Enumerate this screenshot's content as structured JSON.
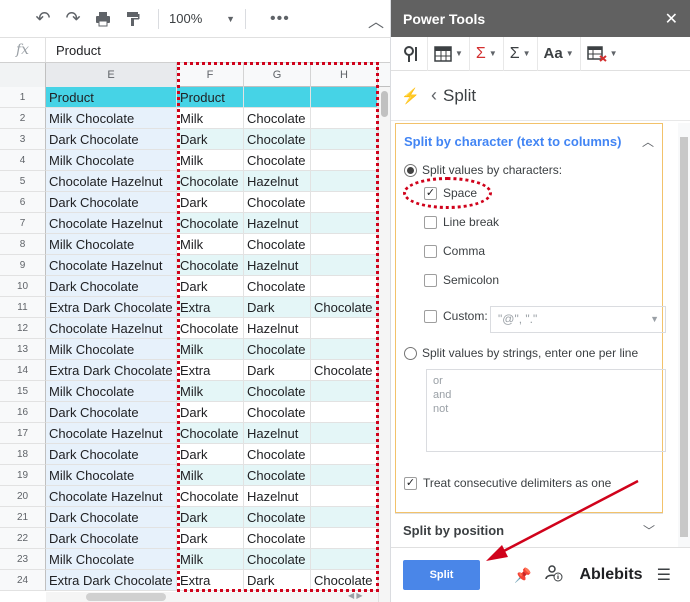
{
  "toolbar": {
    "zoom": "100%"
  },
  "formula_bar": {
    "fx": "fx",
    "value": "Product"
  },
  "columns": [
    "E",
    "F",
    "G",
    "H"
  ],
  "rows": [
    {
      "n": "1",
      "e": "Product",
      "f": "Product",
      "g": "",
      "h": ""
    },
    {
      "n": "2",
      "e": "Milk Chocolate",
      "f": "Milk",
      "g": "Chocolate",
      "h": ""
    },
    {
      "n": "3",
      "e": "Dark Chocolate",
      "f": "Dark",
      "g": "Chocolate",
      "h": ""
    },
    {
      "n": "4",
      "e": "Milk Chocolate",
      "f": "Milk",
      "g": "Chocolate",
      "h": ""
    },
    {
      "n": "5",
      "e": "Chocolate Hazelnut",
      "f": "Chocolate",
      "g": "Hazelnut",
      "h": ""
    },
    {
      "n": "6",
      "e": "Dark Chocolate",
      "f": "Dark",
      "g": "Chocolate",
      "h": ""
    },
    {
      "n": "7",
      "e": "Chocolate Hazelnut",
      "f": "Chocolate",
      "g": "Hazelnut",
      "h": ""
    },
    {
      "n": "8",
      "e": "Milk Chocolate",
      "f": "Milk",
      "g": "Chocolate",
      "h": ""
    },
    {
      "n": "9",
      "e": "Chocolate Hazelnut",
      "f": "Chocolate",
      "g": "Hazelnut",
      "h": ""
    },
    {
      "n": "10",
      "e": "Dark Chocolate",
      "f": "Dark",
      "g": "Chocolate",
      "h": ""
    },
    {
      "n": "11",
      "e": "Extra Dark Chocolate",
      "f": "Extra",
      "g": "Dark",
      "h": "Chocolate"
    },
    {
      "n": "12",
      "e": "Chocolate Hazelnut",
      "f": "Chocolate",
      "g": "Hazelnut",
      "h": ""
    },
    {
      "n": "13",
      "e": "Milk Chocolate",
      "f": "Milk",
      "g": "Chocolate",
      "h": ""
    },
    {
      "n": "14",
      "e": "Extra Dark Chocolate",
      "f": "Extra",
      "g": "Dark",
      "h": "Chocolate"
    },
    {
      "n": "15",
      "e": "Milk Chocolate",
      "f": "Milk",
      "g": "Chocolate",
      "h": ""
    },
    {
      "n": "16",
      "e": "Dark Chocolate",
      "f": "Dark",
      "g": "Chocolate",
      "h": ""
    },
    {
      "n": "17",
      "e": "Chocolate Hazelnut",
      "f": "Chocolate",
      "g": "Hazelnut",
      "h": ""
    },
    {
      "n": "18",
      "e": "Dark Chocolate",
      "f": "Dark",
      "g": "Chocolate",
      "h": ""
    },
    {
      "n": "19",
      "e": "Milk Chocolate",
      "f": "Milk",
      "g": "Chocolate",
      "h": ""
    },
    {
      "n": "20",
      "e": "Chocolate Hazelnut",
      "f": "Chocolate",
      "g": "Hazelnut",
      "h": ""
    },
    {
      "n": "21",
      "e": "Dark Chocolate",
      "f": "Dark",
      "g": "Chocolate",
      "h": ""
    },
    {
      "n": "22",
      "e": "Dark Chocolate",
      "f": "Dark",
      "g": "Chocolate",
      "h": ""
    },
    {
      "n": "23",
      "e": "Milk Chocolate",
      "f": "Milk",
      "g": "Chocolate",
      "h": ""
    },
    {
      "n": "24",
      "e": "Extra Dark Chocolate",
      "f": "Extra",
      "g": "Dark",
      "h": "Chocolate"
    }
  ],
  "panel": {
    "title": "Power Tools",
    "breadcrumb": "Split",
    "section_title": "Split by character (text to columns)",
    "mode_chars_label": "Split values by characters:",
    "opt_space": "Space",
    "opt_linebreak": "Line break",
    "opt_comma": "Comma",
    "opt_semicolon": "Semicolon",
    "opt_custom": "Custom:",
    "custom_placeholder": "\"@\", \".\"",
    "mode_strings_label": "Split values by strings, enter one per line",
    "strings_placeholder": [
      "or",
      "and",
      "not"
    ],
    "treat_consecutive": "Treat consecutive delimiters as one",
    "section2_title": "Split by position",
    "split_button": "Split",
    "brand": "Ablebits",
    "checked": {
      "space": true,
      "linebreak": false,
      "comma": false,
      "semicolon": false,
      "custom": false,
      "consecutive": true
    },
    "selected_mode": "characters"
  },
  "colors": {
    "header_fill": "#46d3e6",
    "highlight": "#d0021b",
    "accent": "#4a86e8"
  }
}
